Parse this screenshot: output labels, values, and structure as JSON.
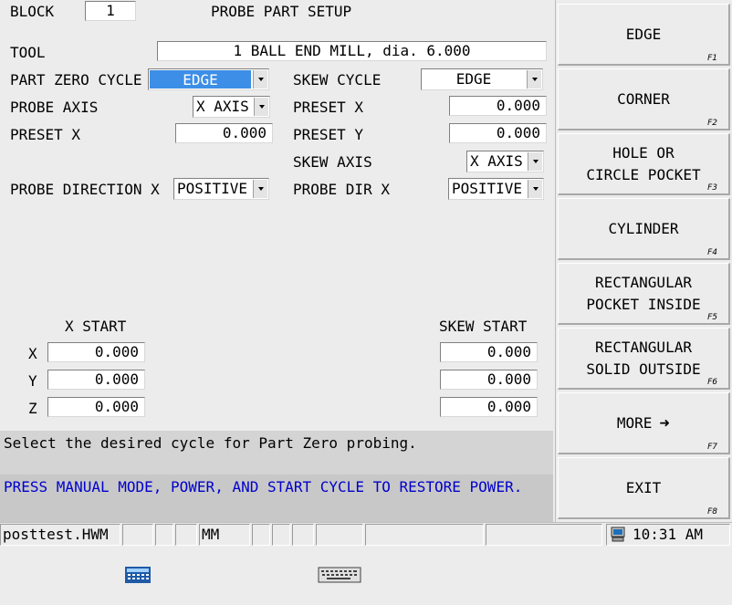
{
  "header": {
    "block_label": "BLOCK",
    "block_value": "1",
    "title": "PROBE PART SETUP"
  },
  "tool": {
    "label": "TOOL",
    "value": "1 BALL END MILL, dia. 6.000"
  },
  "left_panel": {
    "part_zero_cycle_label": "PART ZERO CYCLE",
    "part_zero_cycle_value": "EDGE",
    "probe_axis_label": "PROBE AXIS",
    "probe_axis_value": "X AXIS",
    "preset_x_label": "PRESET X",
    "preset_x_value": "0.000",
    "probe_direction_label": "PROBE DIRECTION X",
    "probe_direction_value": "POSITIVE"
  },
  "right_panel": {
    "skew_cycle_label": "SKEW CYCLE",
    "skew_cycle_value": "EDGE",
    "preset_x_label": "PRESET X",
    "preset_x_value": "0.000",
    "preset_y_label": "PRESET Y",
    "preset_y_value": "0.000",
    "skew_axis_label": "SKEW AXIS",
    "skew_axis_value": "X AXIS",
    "probe_dir_label": "PROBE DIR X",
    "probe_dir_value": "POSITIVE"
  },
  "x_start": {
    "heading": "X START",
    "rows": [
      {
        "axis": "X",
        "value": "0.000"
      },
      {
        "axis": "Y",
        "value": "0.000"
      },
      {
        "axis": "Z",
        "value": "0.000"
      }
    ]
  },
  "skew_start": {
    "heading": "SKEW START",
    "values": [
      "0.000",
      "0.000",
      "0.000"
    ]
  },
  "messages": {
    "prompt": "Select the desired cycle for Part Zero probing.",
    "alert": "PRESS MANUAL MODE, POWER, AND START CYCLE TO RESTORE POWER.",
    "alert_color": "#0000cc"
  },
  "softkeys": [
    {
      "label": "EDGE",
      "fn": "F1"
    },
    {
      "label": "CORNER",
      "fn": "F2"
    },
    {
      "label": "HOLE OR\nCIRCLE POCKET",
      "fn": "F3"
    },
    {
      "label": "CYLINDER",
      "fn": "F4"
    },
    {
      "label": "RECTANGULAR\nPOCKET INSIDE",
      "fn": "F5"
    },
    {
      "label": "RECTANGULAR\nSOLID OUTSIDE",
      "fn": "F6"
    },
    {
      "label": "MORE",
      "fn": "F7",
      "icon": "arrow-right-icon"
    },
    {
      "label": "EXIT",
      "fn": "F8"
    }
  ],
  "statusbar": {
    "filename": "posttest.HWM",
    "units": "MM",
    "time": "10:31 AM",
    "icons": [
      "calculator-icon",
      "keyboard-icon",
      "computer-icon"
    ]
  }
}
